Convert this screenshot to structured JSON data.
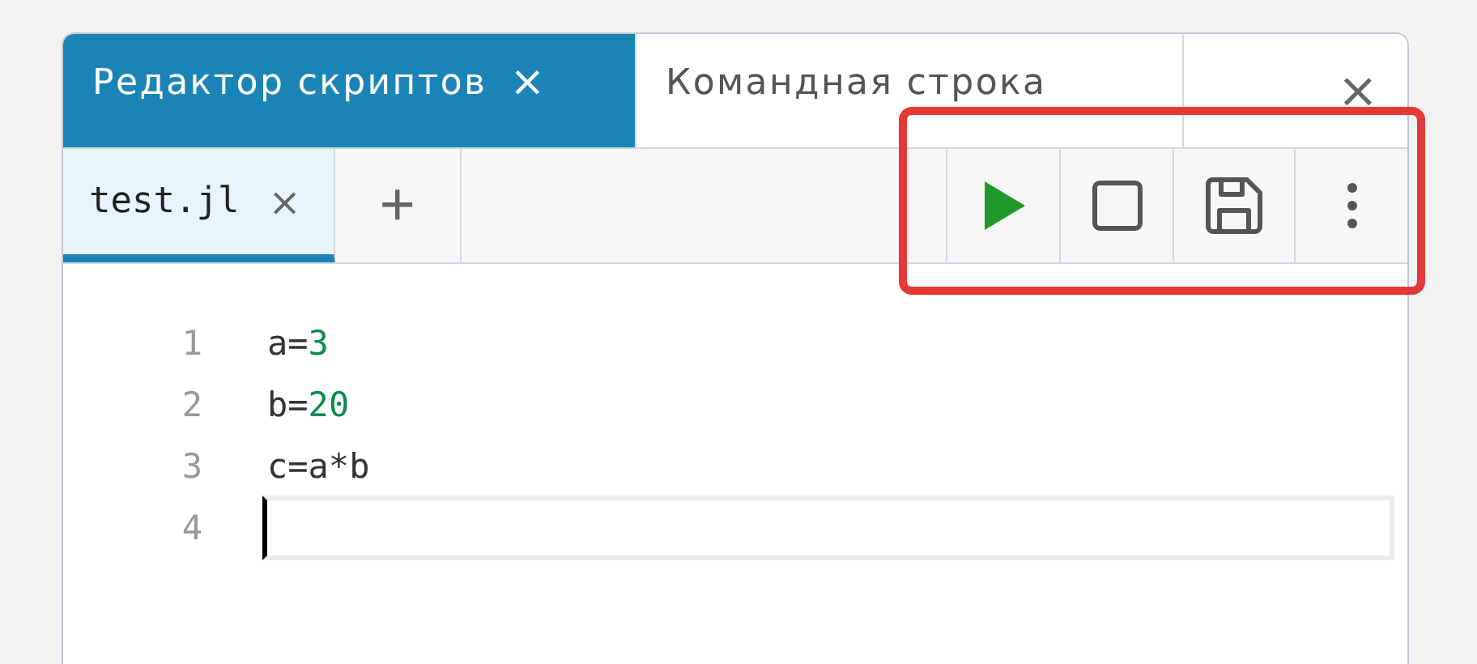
{
  "panel_tabs": [
    {
      "label": "Редактор скриптов",
      "close": "×",
      "selected": true
    },
    {
      "label": "Командная строка",
      "selected": false
    }
  ],
  "panel_close": "×",
  "file_tabs": [
    {
      "label": "test.jl",
      "close": "×",
      "selected": true
    }
  ],
  "add_tab": "+",
  "toolbar": [
    {
      "kind": "run"
    },
    {
      "kind": "stop"
    },
    {
      "kind": "save"
    },
    {
      "kind": "more"
    }
  ],
  "highlight": true,
  "editor": {
    "lines": [
      {
        "number": "1",
        "active": false,
        "tokens": [
          {
            "kind": "plain",
            "text": "a="
          },
          {
            "kind": "number",
            "text": "3"
          }
        ]
      },
      {
        "number": "2",
        "active": false,
        "tokens": [
          {
            "kind": "plain",
            "text": "b="
          },
          {
            "kind": "number",
            "text": "20"
          }
        ]
      },
      {
        "number": "3",
        "active": false,
        "tokens": [
          {
            "kind": "plain",
            "text": "c=a*b"
          }
        ]
      },
      {
        "number": "4",
        "active": true
      }
    ]
  }
}
